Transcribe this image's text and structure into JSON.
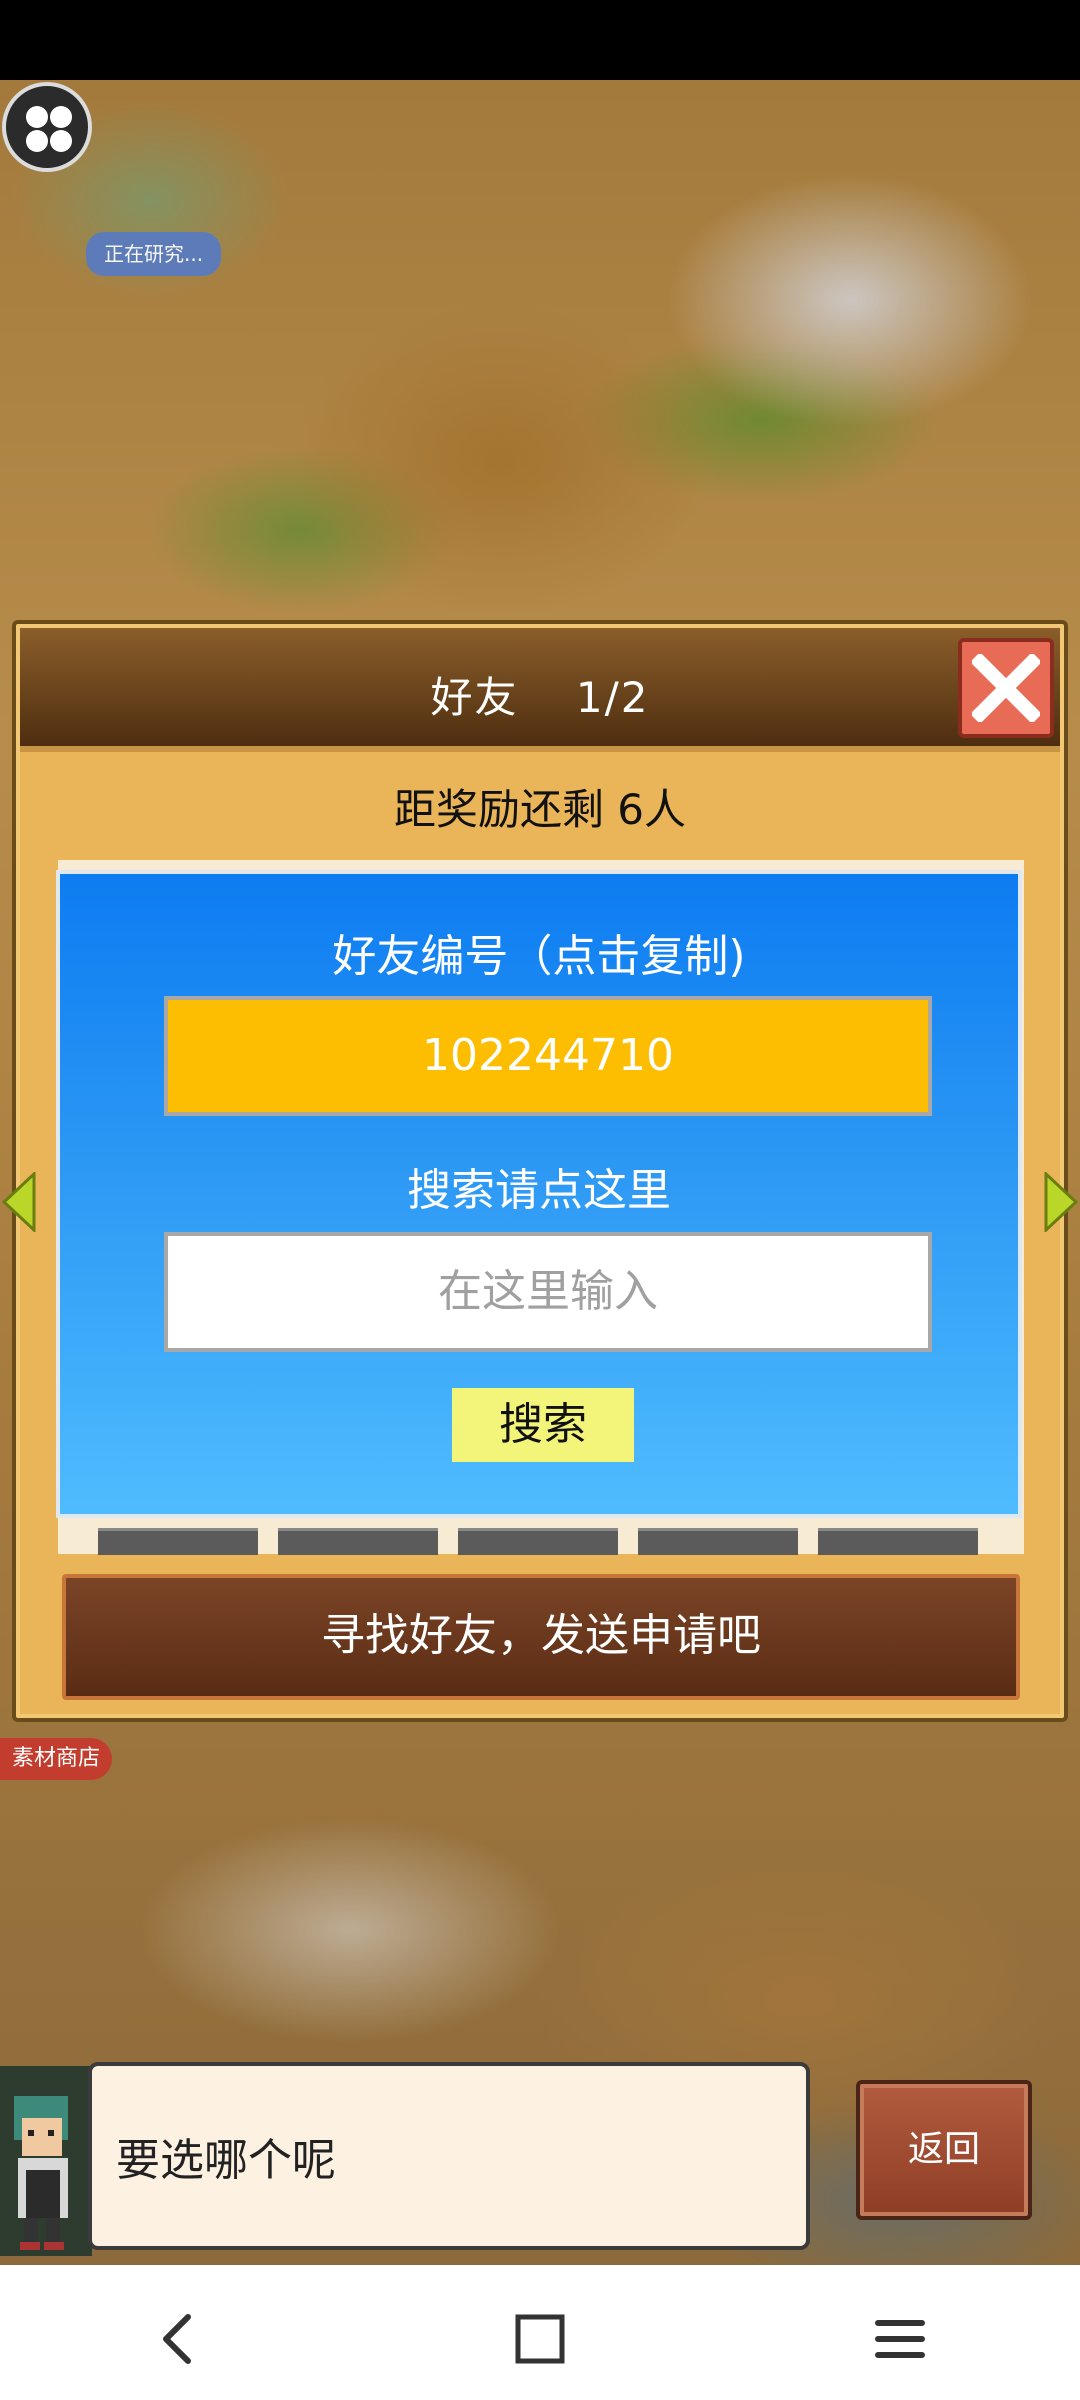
{
  "hud": {
    "research_status": "正在研究...",
    "shop_tag": "素材商店"
  },
  "friends_panel": {
    "title": "好友",
    "page": "1/2",
    "reward_remaining": "距奖励还剩 6人",
    "find_prompt": "寻找好友，发送申请吧"
  },
  "friend_dialog": {
    "friend_id_label": "好友编号（点击复制)",
    "friend_id_value": "102244710",
    "search_label": "搜索请点这里",
    "search_placeholder": "在这里输入",
    "search_button": "搜索"
  },
  "chat": {
    "message": "要选哪个呢",
    "back_button": "返回"
  },
  "colors": {
    "panel_bg": "#e9b558",
    "dialog_blue": "#0d7cf1",
    "id_field": "#fdbd00",
    "search_button": "#f3f47a",
    "close_button": "#e86b56"
  },
  "icons": [
    "menu-grid-icon",
    "close-icon",
    "arrow-left-icon",
    "arrow-right-icon",
    "nav-back-icon",
    "nav-home-icon",
    "nav-menu-icon"
  ]
}
